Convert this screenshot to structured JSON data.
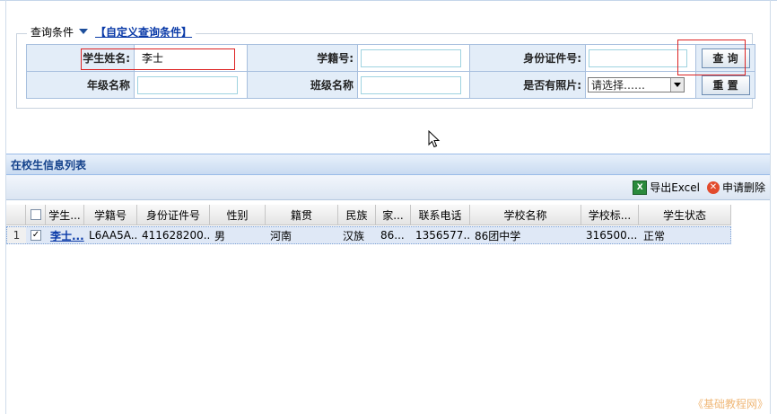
{
  "query": {
    "legend_label": "查询条件",
    "custom_link": "【自定义查询条件】",
    "fields": {
      "student_name_label": "学生姓名:",
      "student_name_value": "李士",
      "student_no_label": "学籍号:",
      "student_no_value": "",
      "id_no_label": "身份证件号:",
      "id_no_value": "",
      "grade_label": "年级名称",
      "grade_value": "",
      "class_label": "班级名称",
      "class_value": "",
      "photo_label": "是否有照片:",
      "photo_selected": "请选择……"
    },
    "search_button": "查 询",
    "reset_button": "重 置"
  },
  "grid": {
    "title": "在校生信息列表",
    "toolbar": {
      "export_label": "导出Excel",
      "delete_label": "申请删除"
    },
    "columns": [
      "学生...",
      "学籍号",
      "身份证件号",
      "性别",
      "籍贯",
      "民族",
      "家...",
      "联系电话",
      "学校名称",
      "学校标...",
      "学生状态"
    ],
    "rows": [
      {
        "index": "1",
        "checked": true,
        "name": "李士...",
        "student_no": "L6AA5A...",
        "id_no": "411628200...",
        "gender": "男",
        "native_place": "河南",
        "ethnicity": "汉族",
        "family": "86...",
        "phone": "1356577...",
        "school": "86团中学",
        "school_code": "316500...",
        "status": "正常"
      }
    ]
  },
  "watermark": "《基础教程网》",
  "colors": {
    "accent": "#15428b",
    "highlight_border": "#dd2222",
    "link": "#0a3aa8"
  }
}
